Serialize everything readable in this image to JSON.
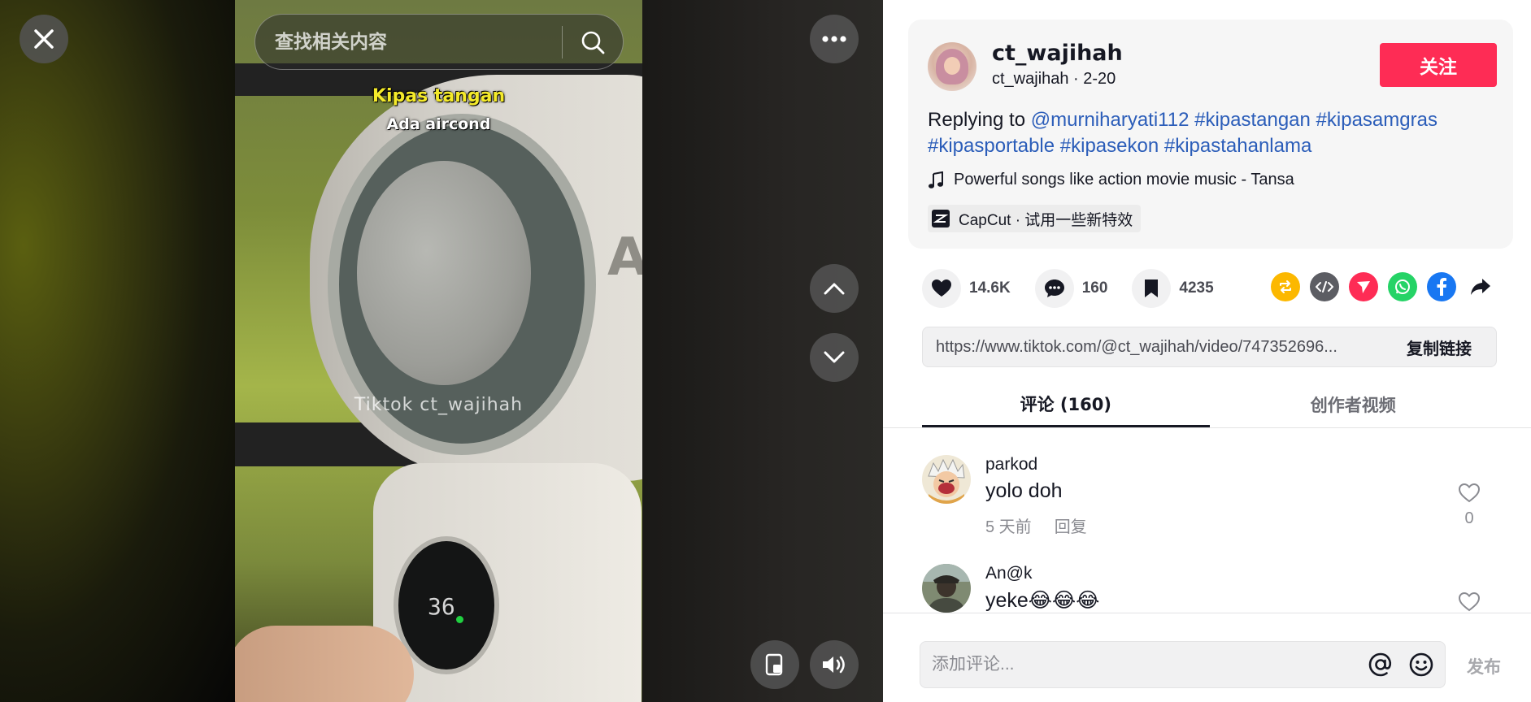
{
  "player": {
    "search_placeholder": "查找相关内容",
    "caption_title": "Kipas tangan",
    "caption_subtitle": "Ada aircond",
    "watermark": "Tiktok ct_wajihah",
    "device_brand": "An",
    "device_display": "36",
    "icons": {
      "close": "close-icon",
      "search": "search-icon",
      "more": "more-dots-icon",
      "up": "chevron-up-icon",
      "down": "chevron-down-icon",
      "pip": "floating-player-icon",
      "volume": "volume-icon"
    }
  },
  "author": {
    "display_name": "ct_wajihah",
    "sub_line": "ct_wajihah · 2-20",
    "follow_label": "关注"
  },
  "description": {
    "prefix": "Replying to ",
    "mention": "@murniharyati112",
    "hashtags": [
      "#kipastangan",
      "#kipasamgras",
      "#kipasportable",
      "#kipasekon",
      "#kipastahanlama"
    ]
  },
  "music": {
    "label": "Powerful songs like action movie music - Tansa"
  },
  "capcut": {
    "label": "CapCut · 试用一些新特效"
  },
  "stats": {
    "likes": "14.6K",
    "comments": "160",
    "saves": "4235"
  },
  "share_icons": [
    "repost-icon",
    "embed-icon",
    "send-icon",
    "whatsapp-icon",
    "facebook-icon",
    "share-arrow-icon"
  ],
  "link": {
    "url": "https://www.tiktok.com/@ct_wajihah/video/747352696...",
    "copy_label": "复制链接"
  },
  "tabs": [
    {
      "label": "评论 (160)",
      "active": true
    },
    {
      "label": "创作者视频",
      "active": false
    }
  ],
  "comments": [
    {
      "name": "parkod",
      "text": "yolo doh",
      "time": "5 天前",
      "reply_label": "回复",
      "likes": "0"
    },
    {
      "name": "An@k",
      "text": "yeke😂😂😂"
    }
  ],
  "composer": {
    "placeholder": "添加评论...",
    "post_label": "发布"
  },
  "colors": {
    "brand_red": "#fe2c55",
    "link_blue": "#2b5db9",
    "text_primary": "#161823",
    "text_secondary": "#8a8b91"
  }
}
